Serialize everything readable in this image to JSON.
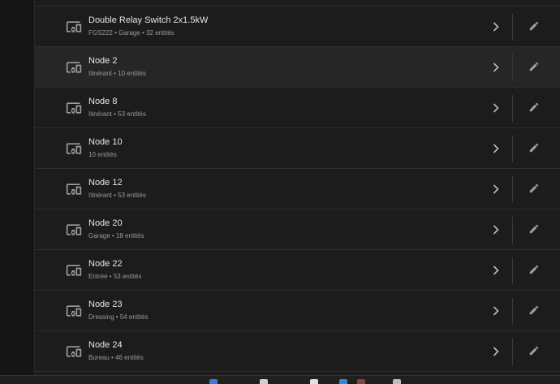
{
  "colors": {
    "background": "#1c1c1c",
    "row_hover": "#262626",
    "divider": "#2f2f2f",
    "title_text": "#e6e6e6",
    "subtitle_text": "#9a9a9a",
    "icon": "#9e9e9e"
  },
  "icons": {
    "device": "devices-icon",
    "row_action": "chevron-right-icon",
    "edit_action": "pencil-icon"
  },
  "devices": [
    {
      "name": "Double Relay Switch 2x1.5kW",
      "subtitle": "FGS222 • Garage • 32 entités"
    },
    {
      "name": "Node 2",
      "subtitle": "Itinérant • 10 entités"
    },
    {
      "name": "Node 8",
      "subtitle": "Itinérant • 53 entités"
    },
    {
      "name": "Node 10",
      "subtitle": "10 entités"
    },
    {
      "name": "Node 12",
      "subtitle": "Itinérant • 53 entités"
    },
    {
      "name": "Node 20",
      "subtitle": "Garage • 18 entités"
    },
    {
      "name": "Node 22",
      "subtitle": "Entrée • 53 entités"
    },
    {
      "name": "Node 23",
      "subtitle": "Dressing • 54 entités"
    },
    {
      "name": "Node 24",
      "subtitle": "Bureau • 46 entités"
    }
  ]
}
